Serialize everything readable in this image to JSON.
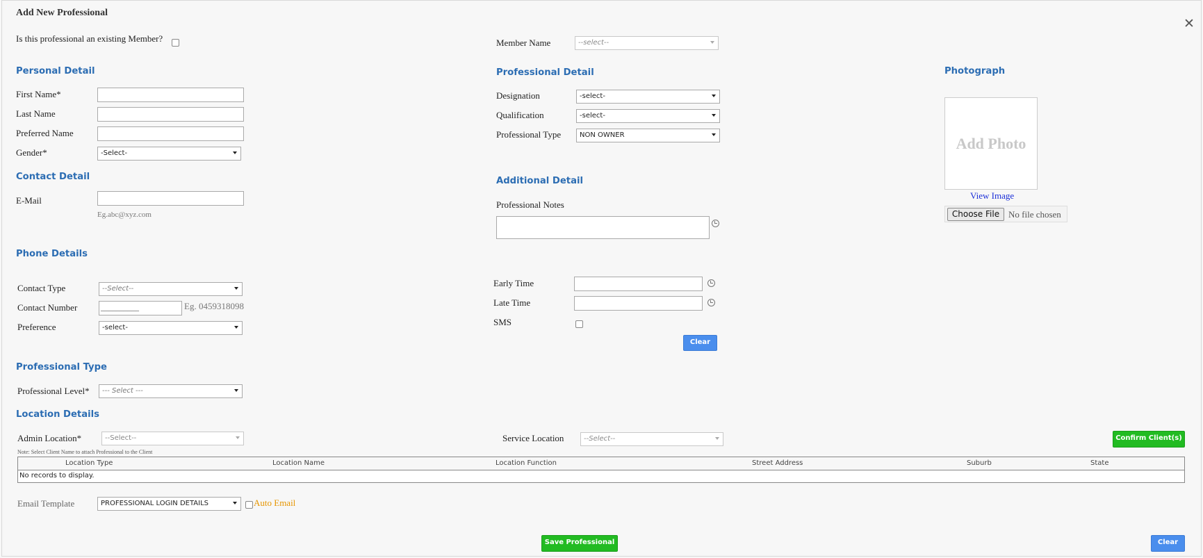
{
  "dialog": {
    "title": "Add New Professional",
    "close_icon": "close-icon"
  },
  "existing_member": {
    "label": "Is this professional an existing Member?",
    "checked": false
  },
  "member_name": {
    "label": "Member Name",
    "selected": "--select--"
  },
  "personal": {
    "heading": "Personal Detail",
    "first_name_label": "First Name*",
    "first_name_value": "",
    "last_name_label": "Last Name",
    "last_name_value": "",
    "preferred_name_label": "Preferred Name",
    "preferred_name_value": "",
    "gender_label": "Gender*",
    "gender_selected": "-Select-"
  },
  "contact": {
    "heading": "Contact Detail",
    "email_label": "E-Mail",
    "email_value": "",
    "email_hint": "Eg.abc@xyz.com"
  },
  "professional_detail": {
    "heading": "Professional Detail",
    "designation_label": "Designation",
    "designation_selected": "-select-",
    "qualification_label": "Qualification",
    "qualification_selected": "-select-",
    "professional_type_label": "Professional Type",
    "professional_type_selected": "NON OWNER"
  },
  "additional": {
    "heading": "Additional Detail",
    "notes_label": "Professional Notes",
    "notes_value": ""
  },
  "photo": {
    "heading": "Photograph",
    "placeholder": "Add Photo",
    "view_link": "View Image",
    "choose_file": "Choose File",
    "file_status": "No file chosen"
  },
  "phone": {
    "heading": "Phone Details",
    "contact_type_label": "Contact Type",
    "contact_type_selected": "--Select--",
    "contact_number_label": "Contact Number",
    "contact_number_value": "__________",
    "contact_number_hint": "Eg. 0459318098",
    "preference_label": "Preference",
    "preference_selected": "-select-",
    "early_time_label": "Early Time",
    "early_time_value": "",
    "late_time_label": "Late Time",
    "late_time_value": "",
    "sms_label": "SMS",
    "sms_checked": false,
    "clear_button": "Clear"
  },
  "professional_type": {
    "heading": "Professional Type",
    "level_label": "Professional Level*",
    "level_selected": "--- Select ---"
  },
  "location": {
    "heading": "Location Details",
    "admin_location_label": "Admin Location*",
    "admin_location_selected": "--Select--",
    "service_location_label": "Service Location",
    "service_location_selected": "--Select--",
    "confirm_button": "Confirm Client(s)",
    "note": "Note: Select Client Name to attach Professional to the Client",
    "table": {
      "columns": [
        "Location Type",
        "Location Name",
        "Location Function",
        "Street Address",
        "Suburb",
        "State"
      ],
      "empty_message": "No records to display."
    }
  },
  "email": {
    "template_label": "Email Template",
    "template_selected": "PROFESSIONAL LOGIN DETAILS",
    "auto_email_label": "Auto Email",
    "auto_email_checked": false
  },
  "footer": {
    "save_button": "Save Professional",
    "clear_button": "Clear"
  },
  "colors": {
    "section_heading": "#2c6db3",
    "primary_button": "#4a8eed",
    "success_button": "#22bb22",
    "auto_email_text": "#e69500",
    "link": "#1b2fd8"
  }
}
